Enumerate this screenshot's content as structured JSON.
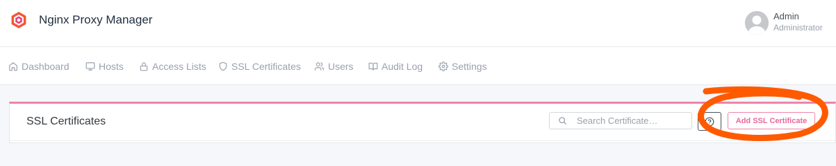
{
  "app": {
    "title": "Nginx Proxy Manager"
  },
  "user": {
    "name": "Admin",
    "role": "Administrator"
  },
  "nav": {
    "items": [
      {
        "label": "Dashboard",
        "icon": "home-icon"
      },
      {
        "label": "Hosts",
        "icon": "monitor-icon"
      },
      {
        "label": "Access Lists",
        "icon": "lock-icon"
      },
      {
        "label": "SSL Certificates",
        "icon": "shield-icon"
      },
      {
        "label": "Users",
        "icon": "users-icon"
      },
      {
        "label": "Audit Log",
        "icon": "book-icon"
      },
      {
        "label": "Settings",
        "icon": "gear-icon"
      }
    ]
  },
  "card": {
    "title": "SSL Certificates",
    "search_placeholder": "Search Certificate…",
    "help_icon": "help-circle-icon",
    "add_label": "Add SSL Certificate"
  },
  "colors": {
    "accent": "#f083a7",
    "accent_text": "#e8689a",
    "annotation": "#ff5a00",
    "nav_text": "#9aa0ac"
  }
}
